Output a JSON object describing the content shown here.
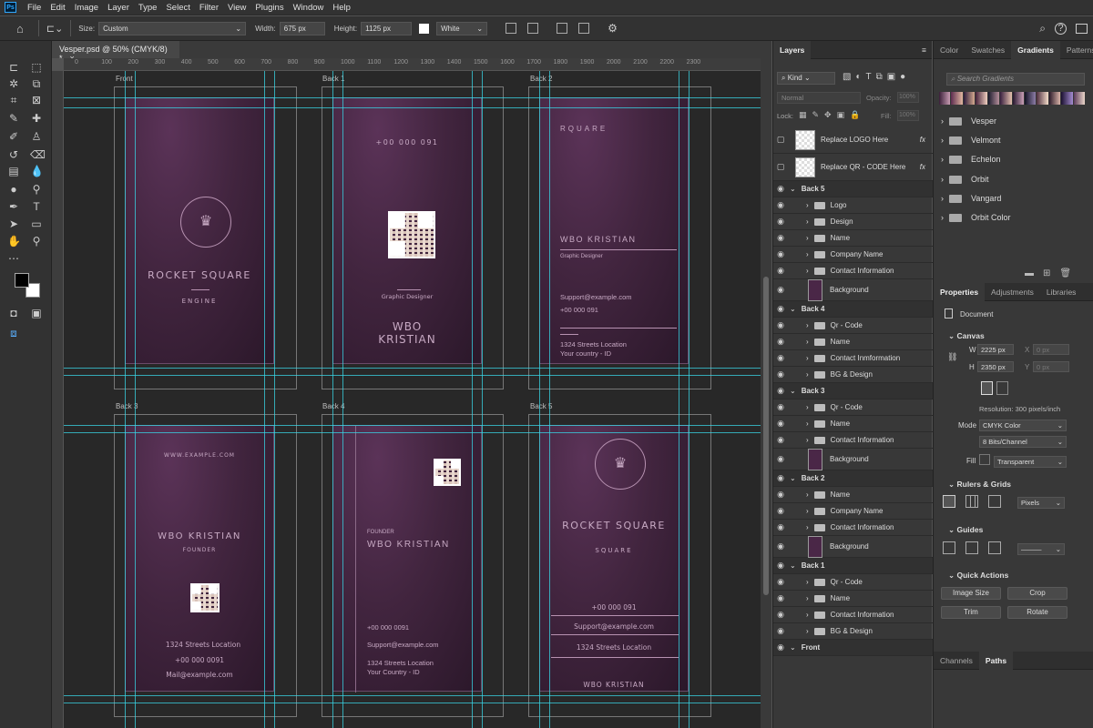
{
  "app": {
    "logo": "Ps",
    "menu": [
      "File",
      "Edit",
      "Image",
      "Layer",
      "Type",
      "Select",
      "Filter",
      "View",
      "Plugins",
      "Window",
      "Help"
    ]
  },
  "options": {
    "size_label": "Size:",
    "size_value": "Custom",
    "width_label": "Width:",
    "width_value": "675 px",
    "height_label": "Height:",
    "height_value": "1125 px",
    "fill_value": "White"
  },
  "document": {
    "tab_title": "Vesper.psd @ 50% (CMYK/8) *"
  },
  "ruler": [
    "0",
    "100",
    "200",
    "300",
    "400",
    "500",
    "600",
    "700",
    "800",
    "900",
    "1000",
    "1100",
    "1200",
    "1300",
    "1400",
    "1500",
    "1600",
    "1700",
    "1800",
    "1900",
    "2000",
    "2100",
    "2200",
    "2300"
  ],
  "artboards": {
    "front": {
      "label": "Front",
      "title": "ROCKET SQUARE",
      "subtitle": "ENGINE"
    },
    "back1": {
      "label": "Back 1",
      "phone": "+00 000 091",
      "role": "Graphic Designer",
      "name1": "WBO",
      "name2": "KRISTIAN"
    },
    "back2": {
      "label": "Back 2",
      "company": "RQUARE",
      "name": "WBO KRISTIAN",
      "role": "Graphic Designer",
      "email": "Support@example.com",
      "phone": "+00 000 091",
      "address": "1324 Streets Location",
      "country": "Your country - ID"
    },
    "back3": {
      "label": "Back 3",
      "website": "WWW.EXAMPLE.COM",
      "name": "WBO KRISTIAN",
      "role": "FOUNDER",
      "address": "1324 Streets Location",
      "phone": "+00 000 0091",
      "email": "Mail@example.com"
    },
    "back4": {
      "label": "Back 4",
      "role": "FOUNDER",
      "name": "WBO KRISTIAN",
      "phone": "+00 000 0091",
      "email": "Support@example.com",
      "address": "1324 Streets Location",
      "country": "Your Country - ID"
    },
    "back5": {
      "label": "Back 5",
      "title": "ROCKET SQUARE",
      "subtitle": "SQUARE",
      "phone": "+00 000 091",
      "email": "Support@example.com",
      "address": "1324 Streets Location",
      "name": "WBO KRISTIAN"
    }
  },
  "layers": {
    "tab": "Layers",
    "filter_kind": "Kind",
    "blend_mode": "Normal",
    "opacity_label": "Opacity:",
    "opacity_value": "100%",
    "lock_label": "Lock:",
    "fill_label": "Fill:",
    "fill_value": "100%",
    "fx_label": "fx",
    "items": [
      {
        "name": "Replace LOGO Here",
        "kind": "smart"
      },
      {
        "name": "Replace QR - CODE Here",
        "kind": "smart"
      },
      {
        "name": "Back 5",
        "kind": "artboard"
      },
      {
        "name": "Logo",
        "kind": "folder"
      },
      {
        "name": "Design",
        "kind": "folder"
      },
      {
        "name": "Name",
        "kind": "folder"
      },
      {
        "name": "Company Name",
        "kind": "folder"
      },
      {
        "name": "Contact Information",
        "kind": "folder"
      },
      {
        "name": "Background",
        "kind": "image"
      },
      {
        "name": "Back 4",
        "kind": "artboard"
      },
      {
        "name": "Qr - Code",
        "kind": "folder"
      },
      {
        "name": "Name",
        "kind": "folder"
      },
      {
        "name": "Contact Inmformation",
        "kind": "folder"
      },
      {
        "name": "BG & Design",
        "kind": "folder"
      },
      {
        "name": "Back 3",
        "kind": "artboard"
      },
      {
        "name": "Qr - Code",
        "kind": "folder"
      },
      {
        "name": "Name",
        "kind": "folder"
      },
      {
        "name": "Contact Information",
        "kind": "folder"
      },
      {
        "name": "Background",
        "kind": "image"
      },
      {
        "name": "Back 2",
        "kind": "artboard"
      },
      {
        "name": "Name",
        "kind": "folder"
      },
      {
        "name": "Company Name",
        "kind": "folder"
      },
      {
        "name": "Contact Information",
        "kind": "folder"
      },
      {
        "name": "Background",
        "kind": "image"
      },
      {
        "name": "Back 1",
        "kind": "artboard"
      },
      {
        "name": "Qr - Code",
        "kind": "folder"
      },
      {
        "name": "Name",
        "kind": "folder"
      },
      {
        "name": "Contact Information",
        "kind": "folder"
      },
      {
        "name": "BG & Design",
        "kind": "folder"
      },
      {
        "name": "Front",
        "kind": "artboard"
      }
    ]
  },
  "right": {
    "tabs": [
      "Color",
      "Swatches",
      "Gradients",
      "Patterns"
    ],
    "search_placeholder": "Search Gradients",
    "gradient_folders": [
      "Vesper",
      "Velmont",
      "Echelon",
      "Orbit",
      "Vangard",
      "Orbit Color"
    ],
    "prop_tabs": [
      "Properties",
      "Adjustments",
      "Libraries"
    ],
    "doc_label": "Document",
    "canvas_title": "Canvas",
    "w_label": "W",
    "w_value": "2225 px",
    "x_label": "X",
    "x_value": "0 px",
    "h_label": "H",
    "h_value": "2350 px",
    "y_label": "Y",
    "y_value": "0 px",
    "resolution": "Resolution: 300 pixels/inch",
    "mode_label": "Mode",
    "mode_value": "CMYK Color",
    "bits_value": "8 Bits/Channel",
    "fill_label": "Fill",
    "fill_value": "Transparent",
    "rulers_title": "Rulers & Grids",
    "units_value": "Pixels",
    "guides_title": "Guides",
    "quick_title": "Quick Actions",
    "btn_image_size": "Image Size",
    "btn_crop": "Crop",
    "btn_trim": "Trim",
    "btn_rotate": "Rotate",
    "bottom_tabs": [
      "Channels",
      "Paths"
    ]
  }
}
